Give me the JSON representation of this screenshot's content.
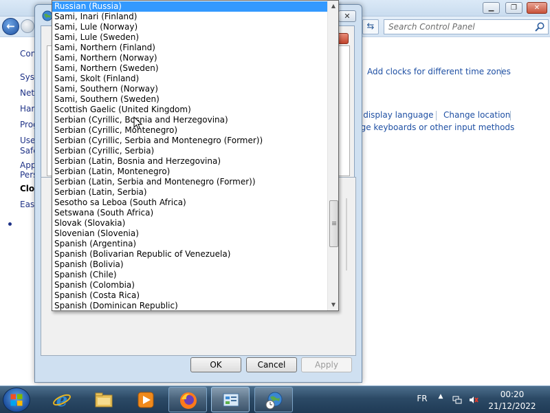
{
  "control_panel": {
    "search_placeholder": "Search Control Panel",
    "sidebar": [
      "Con",
      "Syst",
      "Netw",
      "Hard",
      "Prog",
      "User",
      "Safe",
      "App",
      "Pers",
      "Clock",
      "Ease"
    ],
    "links": {
      "add_clocks": "Add clocks for different time zones",
      "display_language": "e display language",
      "change_location": "Change location",
      "keyboards": "nge keyboards or other input methods"
    },
    "caption_buttons": [
      "minimize",
      "restore",
      "close"
    ]
  },
  "dialog": {
    "ok_label": "OK",
    "cancel_label": "Cancel",
    "apply_label": "Apply",
    "close_glyph": "✕"
  },
  "dropdown": {
    "selected": "Russian (Russia)",
    "items": [
      "Russian (Russia)",
      "Sami, Inari (Finland)",
      "Sami, Lule (Norway)",
      "Sami, Lule (Sweden)",
      "Sami, Northern (Finland)",
      "Sami, Northern (Norway)",
      "Sami, Northern (Sweden)",
      "Sami, Skolt (Finland)",
      "Sami, Southern (Norway)",
      "Sami, Southern (Sweden)",
      "Scottish Gaelic (United Kingdom)",
      "Serbian (Cyrillic, Bosnia and Herzegovina)",
      "Serbian (Cyrillic, Montenegro)",
      "Serbian (Cyrillic, Serbia and Montenegro (Former))",
      "Serbian (Cyrillic, Serbia)",
      "Serbian (Latin, Bosnia and Herzegovina)",
      "Serbian (Latin, Montenegro)",
      "Serbian (Latin, Serbia and Montenegro (Former))",
      "Serbian (Latin, Serbia)",
      "Sesotho sa Leboa (South Africa)",
      "Setswana (South Africa)",
      "Slovak (Slovakia)",
      "Slovenian (Slovenia)",
      "Spanish (Argentina)",
      "Spanish (Bolivarian Republic of Venezuela)",
      "Spanish (Bolivia)",
      "Spanish (Chile)",
      "Spanish (Colombia)",
      "Spanish (Costa Rica)",
      "Spanish (Dominican Republic)"
    ],
    "scroll_position": 0.65
  },
  "taskbar": {
    "apps": [
      "internet-explorer",
      "windows-explorer",
      "media-player",
      "firefox",
      "control-panel",
      "region-language"
    ],
    "language": "FR",
    "time": "00:20",
    "date": "21/12/2022"
  },
  "colors": {
    "selection": "#3399ff",
    "link": "#1e4fa3",
    "taskbar": "#2c4a66"
  }
}
